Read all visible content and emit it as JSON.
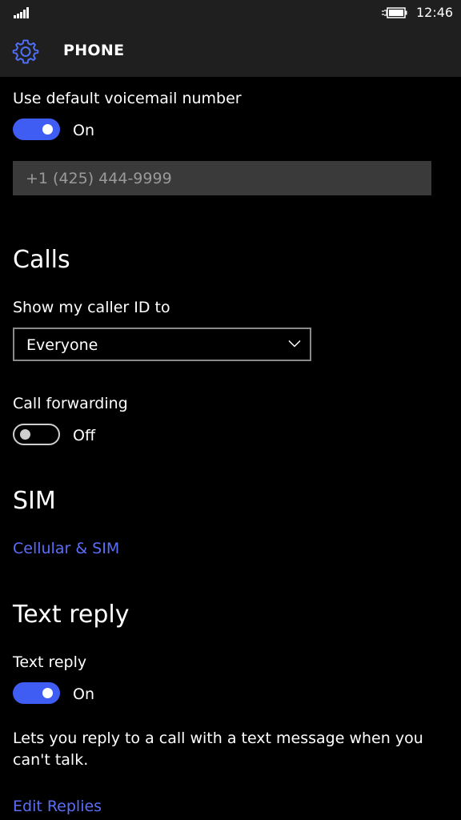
{
  "status_bar": {
    "time": "12:46",
    "signal_icon": "signal-strength-icon",
    "battery_icon": "battery-charging-icon"
  },
  "header": {
    "icon": "gear-icon",
    "title": "PHONE",
    "accent_color": "#3f5df2"
  },
  "voicemail": {
    "label": "Use default voicemail number",
    "toggle_state": "On",
    "number_placeholder": "+1 (425) 444-9999"
  },
  "calls": {
    "section_title": "Calls",
    "caller_id_label": "Show my caller ID to",
    "caller_id_value": "Everyone",
    "forwarding_label": "Call forwarding",
    "forwarding_state": "Off"
  },
  "sim": {
    "section_title": "SIM",
    "link": "Cellular & SIM"
  },
  "text_reply": {
    "section_title": "Text reply",
    "label": "Text reply",
    "toggle_state": "On",
    "description": "Lets you reply to a call with a text message when you can't talk.",
    "link": "Edit Replies"
  }
}
